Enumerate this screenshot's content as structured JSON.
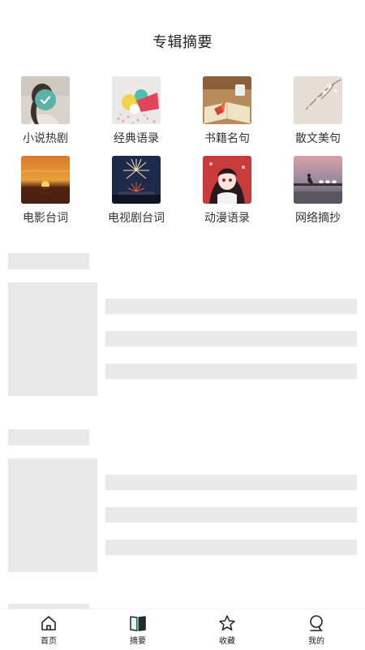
{
  "page": {
    "title": "专辑摘要"
  },
  "categories": [
    {
      "label": "小说热剧",
      "icon": "novel-thumb-icon",
      "selected": true
    },
    {
      "label": "经典语录",
      "icon": "classic-quotes-thumb-icon"
    },
    {
      "label": "书籍名句",
      "icon": "book-quotes-thumb-icon"
    },
    {
      "label": "散文美句",
      "icon": "prose-thumb-icon"
    },
    {
      "label": "电影台词",
      "icon": "movie-lines-thumb-icon"
    },
    {
      "label": "电视剧台词",
      "icon": "tv-lines-thumb-icon"
    },
    {
      "label": "动漫语录",
      "icon": "anime-quotes-thumb-icon"
    },
    {
      "label": "网络摘抄",
      "icon": "web-excerpts-thumb-icon"
    }
  ],
  "colors": {
    "accent": "#5ab3a6",
    "skeleton": "#e9e9e9"
  },
  "tabbar": {
    "items": [
      {
        "label": "首页",
        "icon": "home-icon"
      },
      {
        "label": "摘要",
        "icon": "book-icon",
        "active": true
      },
      {
        "label": "收藏",
        "icon": "star-icon"
      },
      {
        "label": "我的",
        "icon": "profile-icon"
      }
    ]
  }
}
